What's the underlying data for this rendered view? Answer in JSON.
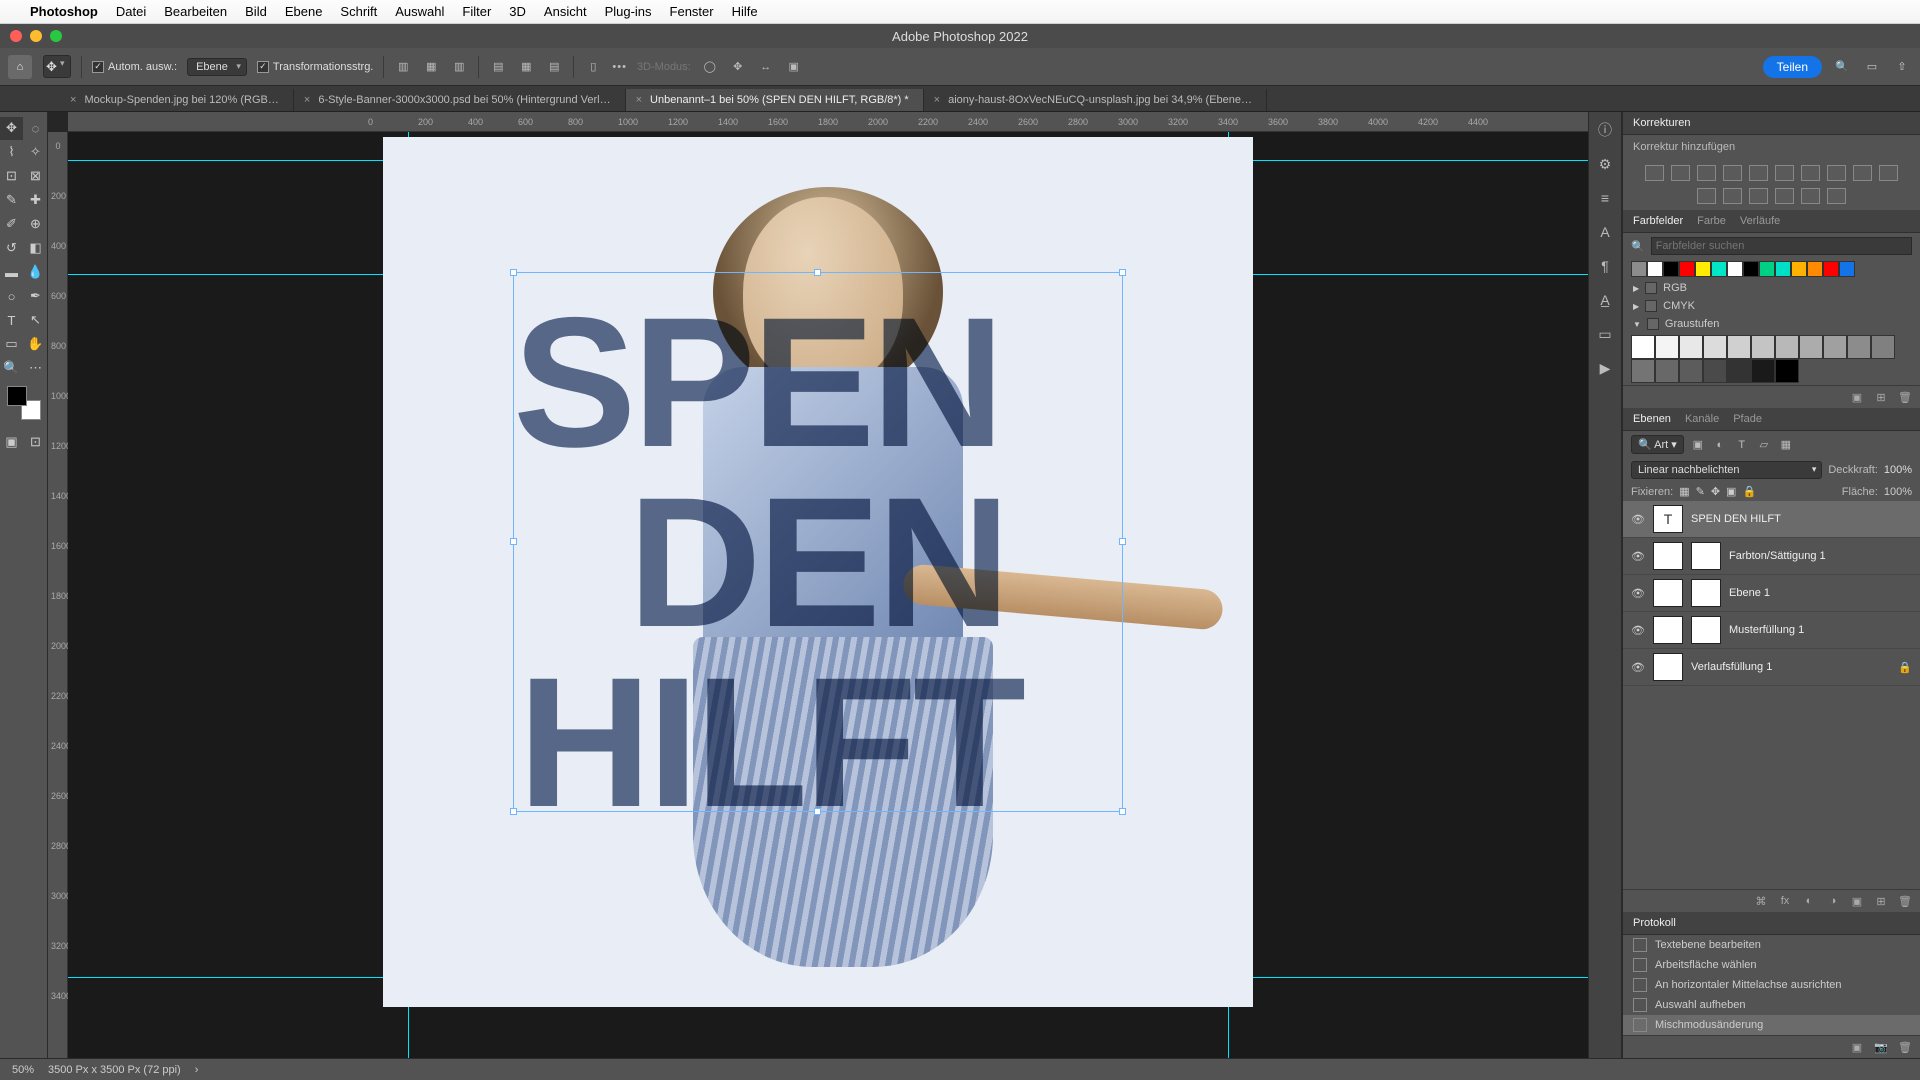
{
  "mac_menu": {
    "app": "Photoshop",
    "items": [
      "Datei",
      "Bearbeiten",
      "Bild",
      "Ebene",
      "Schrift",
      "Auswahl",
      "Filter",
      "3D",
      "Ansicht",
      "Plug-ins",
      "Fenster",
      "Hilfe"
    ]
  },
  "titlebar": {
    "title": "Adobe Photoshop 2022"
  },
  "optbar": {
    "auto_select": "Autom. ausw.:",
    "auto_select_target": "Ebene",
    "show_transform": "Transformationsstrg.",
    "mode3d": "3D-Modus:",
    "teilen": "Teilen"
  },
  "tabs": [
    {
      "label": "Mockup-Spenden.jpg bei 120% (RGB…",
      "active": false
    },
    {
      "label": "6-Style-Banner-3000x3000.psd bei 50% (Hintergrund Verl…",
      "active": false
    },
    {
      "label": "Unbenannt–1 bei 50% (SPEN   DEN HILFT, RGB/8*) *",
      "active": true
    },
    {
      "label": "aiony-haust-8OxVecNEuCQ-unsplash.jpg bei 34,9% (Ebene…",
      "active": false
    }
  ],
  "ruler_h": [
    "0",
    "200",
    "400",
    "600",
    "800",
    "1000",
    "1200",
    "1400",
    "1600",
    "1800",
    "2000",
    "2200",
    "2400",
    "2600",
    "2800",
    "3000",
    "3200",
    "3400",
    "3600",
    "3800",
    "4000",
    "4200",
    "4400"
  ],
  "ruler_v": [
    "0",
    "200",
    "400",
    "600",
    "800",
    "1000",
    "1200",
    "1400",
    "1600",
    "1800",
    "2000",
    "2200",
    "2400",
    "2600",
    "2800",
    "3000",
    "3200",
    "3400"
  ],
  "artwork": {
    "line1": "SPEN",
    "line2": "DEN",
    "line3": "HILFT"
  },
  "korrekturen": {
    "title": "Korrekturen",
    "add": "Korrektur hinzufügen"
  },
  "farbfelder": {
    "tabs": [
      "Farbfelder",
      "Farbe",
      "Verläufe"
    ],
    "search_ph": "Farbfelder suchen",
    "swatches": [
      "#8c8c8c",
      "#ffffff",
      "#000000",
      "#ff0000",
      "#ffec00",
      "#00e6c7",
      "#ffffff",
      "#000000",
      "#00d084",
      "#00e0c7",
      "#ffb100",
      "#ff8a00",
      "#ff0000",
      "#1473e6"
    ],
    "groups": [
      {
        "name": "RGB",
        "open": false
      },
      {
        "name": "CMYK",
        "open": false
      },
      {
        "name": "Graustufen",
        "open": true
      }
    ],
    "grays": [
      "#ffffff",
      "#f4f4f4",
      "#e8e8e8",
      "#dcdcdc",
      "#d0d0d0",
      "#c4c4c4",
      "#b8b8b8",
      "#acacac",
      "#a0a0a0",
      "#8c8c8c",
      "#808080",
      "#747474",
      "#686868",
      "#5c5c5c",
      "#4a4a4a",
      "#333333",
      "#1a1a1a",
      "#000000"
    ]
  },
  "ebenen": {
    "tabs": [
      "Ebenen",
      "Kanäle",
      "Pfade"
    ],
    "filter": "Art",
    "blend": "Linear nachbelichten",
    "opacity_label": "Deckkraft:",
    "opacity": "100%",
    "lock_label": "Fixieren:",
    "fill_label": "Fläche:",
    "fill": "100%",
    "layers": [
      {
        "name": "SPEN   DEN HILFT",
        "type": "T",
        "selected": true,
        "mask": false
      },
      {
        "name": "Farbton/Sättigung 1",
        "type": "adj",
        "mask": true
      },
      {
        "name": "Ebene 1",
        "type": "img",
        "mask": true
      },
      {
        "name": "Musterfüllung 1",
        "type": "pat",
        "mask": true
      },
      {
        "name": "Verlaufsfüllung 1",
        "type": "grad",
        "mask": false,
        "locked": true
      }
    ]
  },
  "protokoll": {
    "title": "Protokoll",
    "items": [
      "Textebene bearbeiten",
      "Arbeitsfläche wählen",
      "An horizontaler Mittelachse ausrichten",
      "Auswahl aufheben",
      "Mischmodusänderung"
    ],
    "selected": 4
  },
  "status": {
    "zoom": "50%",
    "docinfo": "3500 Px x 3500 Px (72 ppi)"
  }
}
